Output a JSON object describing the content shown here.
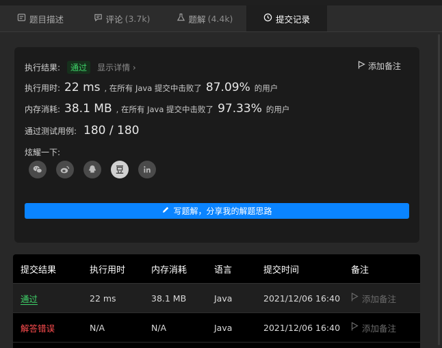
{
  "tabs": [
    {
      "icon": "description-icon",
      "label": "题目描述",
      "count": ""
    },
    {
      "icon": "comment-icon",
      "label": "评论",
      "count": "(3.7k)"
    },
    {
      "icon": "flask-icon",
      "label": "题解",
      "count": "(4.4k)"
    },
    {
      "icon": "clock-icon",
      "label": "提交记录",
      "count": ""
    }
  ],
  "result": {
    "label": "执行结果:",
    "status": "通过",
    "details": "显示详情 ›",
    "add_note": "添加备注",
    "runtime_label": "执行用时:",
    "runtime": "22 ms",
    "memory_label": "内存消耗:",
    "memory": "38.1 MB",
    "beat_prefix": ", 在所有 Java 提交中击败了",
    "runtime_beat": "87.09%",
    "memory_beat": "97.33%",
    "beat_suffix": "的用户",
    "tests_label": "通过测试用例:",
    "tests": "180 / 180",
    "share_label": "炫耀一下:",
    "write_button": "写题解，分享我的解题思路"
  },
  "share_icons": [
    "wechat-icon",
    "weibo-icon",
    "qq-icon",
    "douban-icon",
    "linkedin-icon"
  ],
  "table": {
    "headers": [
      "提交结果",
      "执行用时",
      "内存消耗",
      "语言",
      "提交时间",
      "备注"
    ],
    "rows": [
      {
        "status": "通过",
        "status_type": "ok",
        "runtime": "22 ms",
        "memory": "38.1 MB",
        "lang": "Java",
        "time": "2021/12/06 16:40",
        "note": "添加备注"
      },
      {
        "status": "解答错误",
        "status_type": "err",
        "runtime": "N/A",
        "memory": "N/A",
        "lang": "Java",
        "time": "2021/12/06 16:40",
        "note": "添加备注"
      }
    ]
  },
  "colors": {
    "accent": "#0a84ff",
    "success": "#3fd56a",
    "error": "#ff4d4f"
  }
}
